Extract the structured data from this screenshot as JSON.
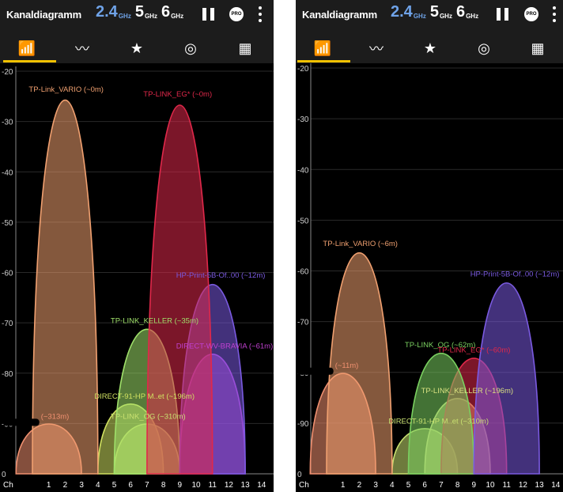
{
  "screens": [
    {
      "app_title": "Kanaldiagramm",
      "bands": [
        {
          "value": "2.4",
          "unit": "GHz",
          "active": true
        },
        {
          "value": "5",
          "unit": "GHz",
          "active": false
        },
        {
          "value": "6",
          "unit": "GHz",
          "active": false
        }
      ],
      "pro_badge": "PRO",
      "tabs": [
        {
          "icon": "channel-graph-icon",
          "glyph": "📶",
          "selected": true
        },
        {
          "icon": "time-graph-icon",
          "glyph": "〰",
          "selected": false
        },
        {
          "icon": "channel-rating-icon",
          "glyph": "★",
          "selected": false
        },
        {
          "icon": "access-points-icon",
          "glyph": "◎",
          "selected": false
        },
        {
          "icon": "dashboard-icon",
          "glyph": "▦",
          "selected": false
        }
      ]
    },
    {
      "app_title": "Kanaldiagramm",
      "bands": [
        {
          "value": "2.4",
          "unit": "GHz",
          "active": true
        },
        {
          "value": "5",
          "unit": "GHz",
          "active": false
        },
        {
          "value": "6",
          "unit": "GHz",
          "active": false
        }
      ],
      "pro_badge": "PRO",
      "tabs": [
        {
          "icon": "channel-graph-icon",
          "glyph": "📶",
          "selected": true
        },
        {
          "icon": "time-graph-icon",
          "glyph": "〰",
          "selected": false
        },
        {
          "icon": "channel-rating-icon",
          "glyph": "★",
          "selected": false
        },
        {
          "icon": "access-points-icon",
          "glyph": "◎",
          "selected": false
        },
        {
          "icon": "dashboard-icon",
          "glyph": "▦",
          "selected": false
        }
      ]
    }
  ],
  "chart_data": [
    {
      "type": "area",
      "x_axis_label": "Ch",
      "x_ticks": [
        1,
        2,
        3,
        4,
        5,
        6,
        7,
        8,
        9,
        10,
        11,
        12,
        13,
        14
      ],
      "y_ticks": [
        -20,
        -30,
        -40,
        -50,
        -60,
        -70,
        -80,
        -90
      ],
      "y_bottom_label": "0",
      "ylim": [
        -100,
        -20
      ],
      "networks": [
        {
          "name": "TP-Link_VARIO (~0m)",
          "channel": 2,
          "dbm": -25,
          "color": "#f0a070"
        },
        {
          "name": "TP-LINK_EG* (~0m)",
          "channel": 9,
          "dbm": -26,
          "color": "#e0284a"
        },
        {
          "name": "HP-Print-5B-Of..00 (~12m)",
          "channel": 11,
          "dbm": -62,
          "color": "#7a5ae0"
        },
        {
          "name": "TP-LINK_KELLER (~35m)",
          "channel": 7,
          "dbm": -71,
          "color": "#9fe06a"
        },
        {
          "name": "DIRECT-WV-BRAVIA (~61m)",
          "channel": 11,
          "dbm": -76,
          "color": "#c040d0"
        },
        {
          "name": "DIRECT-91-HP M..et (~196m)",
          "channel": 6,
          "dbm": -86,
          "color": "#d0e060"
        },
        {
          "name": "TP-LINK_OG (~310m)",
          "channel": 7,
          "dbm": -90,
          "color": "#c8e070"
        },
        {
          "name": "(~313m)",
          "channel": 1,
          "dbm": -90,
          "color": "#f09070",
          "redacted": true
        }
      ]
    },
    {
      "type": "area",
      "x_axis_label": "Ch",
      "x_ticks": [
        1,
        2,
        3,
        4,
        5,
        6,
        7,
        8,
        9,
        10,
        11,
        12,
        13,
        14
      ],
      "y_ticks": [
        -20,
        -30,
        -40,
        -50,
        -60,
        -70,
        -80,
        -90
      ],
      "y_bottom_label": "0",
      "ylim": [
        -100,
        -20
      ],
      "networks": [
        {
          "name": "TP-Link_VARIO (~6m)",
          "channel": 2,
          "dbm": -56,
          "color": "#f0a070"
        },
        {
          "name": "HP-Print-5B-Of..00 (~12m)",
          "channel": 11,
          "dbm": -62,
          "color": "#7a5ae0"
        },
        {
          "name": "TP-LINK_OG (~62m)",
          "channel": 7,
          "dbm": -76,
          "color": "#7ad060"
        },
        {
          "name": "TP-LINK_EG* (~60m)",
          "channel": 9,
          "dbm": -77,
          "color": "#e0284a"
        },
        {
          "name": "(~11m)",
          "channel": 1,
          "dbm": -80,
          "color": "#f09070",
          "redacted": true
        },
        {
          "name": "TP-LINK_KELLER (~196m)",
          "channel": 8,
          "dbm": -85,
          "color": "#d8e080"
        },
        {
          "name": "DIRECT-91-HP M..et (~310m)",
          "channel": 6,
          "dbm": -91,
          "color": "#c8e070"
        }
      ]
    }
  ]
}
